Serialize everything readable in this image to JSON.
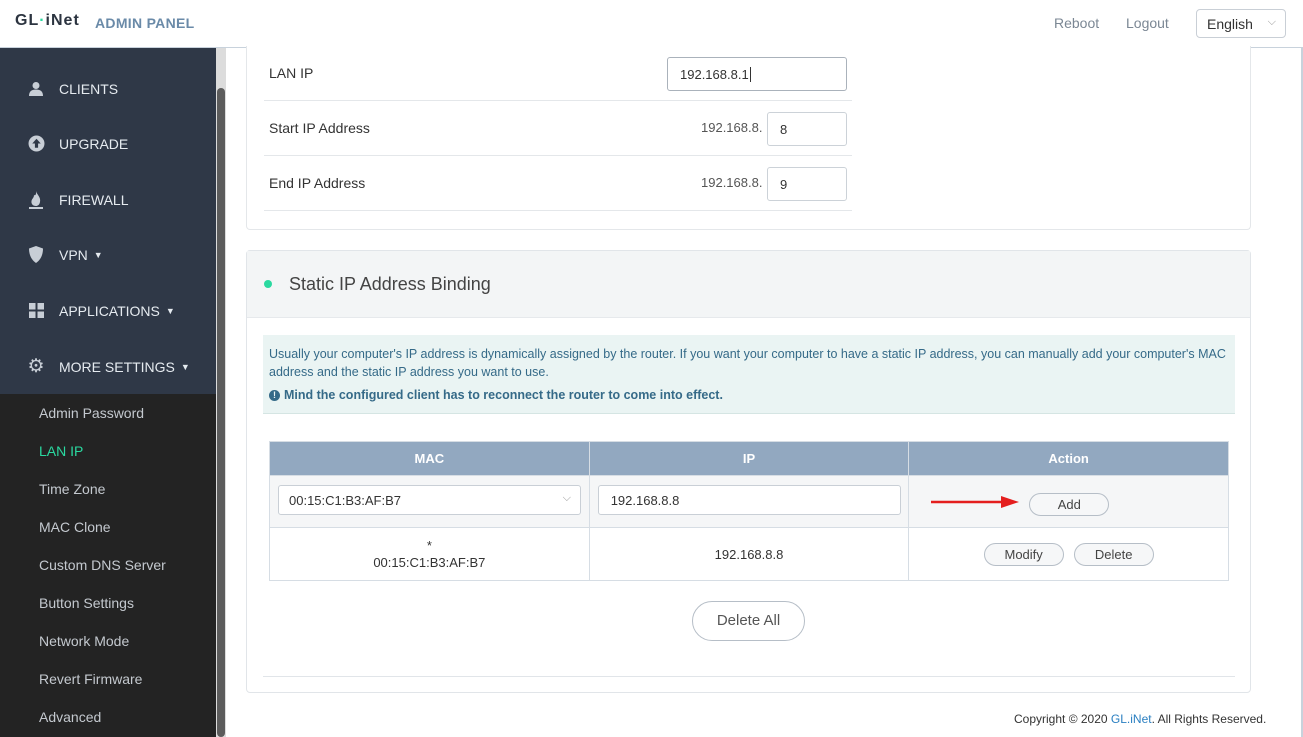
{
  "header": {
    "logo_left": "GL",
    "logo_dot": "·",
    "logo_right": "iNet",
    "panel_title": "ADMIN PANEL",
    "reboot": "Reboot",
    "logout": "Logout",
    "language": "English"
  },
  "sidebar": {
    "items": [
      {
        "label": "CLIENTS",
        "icon": "user-icon"
      },
      {
        "label": "UPGRADE",
        "icon": "upload-icon"
      },
      {
        "label": "FIREWALL",
        "icon": "flame-icon"
      },
      {
        "label": "VPN",
        "icon": "shield-icon"
      },
      {
        "label": "APPLICATIONS",
        "icon": "grid-icon"
      },
      {
        "label": "MORE SETTINGS",
        "icon": "gear-icon"
      }
    ],
    "submenu": [
      "Admin Password",
      "LAN IP",
      "Time Zone",
      "MAC Clone",
      "Custom DNS Server",
      "Button Settings",
      "Network Mode",
      "Revert Firmware",
      "Advanced"
    ],
    "active_submenu": "LAN IP"
  },
  "lan": {
    "lan_ip_label": "LAN IP",
    "lan_ip_value": "192.168.8.1",
    "start_label": "Start IP Address",
    "start_prefix": "192.168.8.",
    "start_value": "8",
    "end_label": "End IP Address",
    "end_prefix": "192.168.8.",
    "end_value": "9"
  },
  "static_binding": {
    "title": "Static IP Address Binding",
    "info": "Usually your computer's IP address is dynamically assigned by the router. If you want your computer to have a static IP address, you can manually add your computer's MAC address and the static IP address you want to use.",
    "warning": "Mind the configured client has to reconnect the router to come into effect.",
    "columns": [
      "MAC",
      "IP",
      "Action"
    ],
    "edit_row": {
      "mac_selected": "00:15:C1:B3:AF:B7",
      "ip_value": "192.168.8.8",
      "add_label": "Add"
    },
    "rows": [
      {
        "mac_mark": "*",
        "mac": "00:15:C1:B3:AF:B7",
        "ip": "192.168.8.8",
        "modify_label": "Modify",
        "delete_label": "Delete"
      }
    ],
    "delete_all_label": "Delete All",
    "annotation_arrow_color": "#e41e1e"
  },
  "footer": {
    "prefix": "Copyright © 2020 ",
    "brand": "GL.iNet",
    "suffix": ". All Rights Reserved."
  },
  "colors": {
    "accent": "#2ad9a0",
    "sidebar_bg": "#2f3847",
    "table_header": "#92a8c0"
  }
}
